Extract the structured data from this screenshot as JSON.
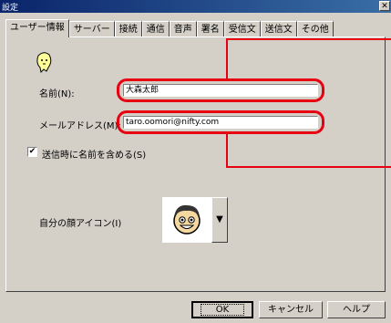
{
  "window": {
    "title": "設定",
    "close_glyph": "✕"
  },
  "tabs": [
    {
      "label": "ユーザー情報",
      "active": true
    },
    {
      "label": "サーバー"
    },
    {
      "label": "接続"
    },
    {
      "label": "通信"
    },
    {
      "label": "音声"
    },
    {
      "label": "署名"
    },
    {
      "label": "受信文"
    },
    {
      "label": "送信文"
    },
    {
      "label": "その他"
    }
  ],
  "form": {
    "name_label": "名前(N):",
    "name_value": "大森太郎",
    "email_label": "メールアドレス(M):",
    "email_value": "taro.oomori@nifty.com",
    "include_name_label": "送信時に名前を含める(S)",
    "include_name_checked": true,
    "face_icon_label": "自分の顔アイコン(I)",
    "dropdown_glyph": "▼",
    "check_glyph": "✔"
  },
  "buttons": {
    "ok": "OK",
    "cancel": "キャンセル",
    "help": "ヘルプ"
  },
  "colors": {
    "annotation_red": "#e60012",
    "titlebar": "#0a246a",
    "face": "#5a5a5a"
  },
  "icons": [
    "default-face-icon",
    "smiling-face-icon",
    "dropdown-arrow-icon",
    "close-icon"
  ]
}
